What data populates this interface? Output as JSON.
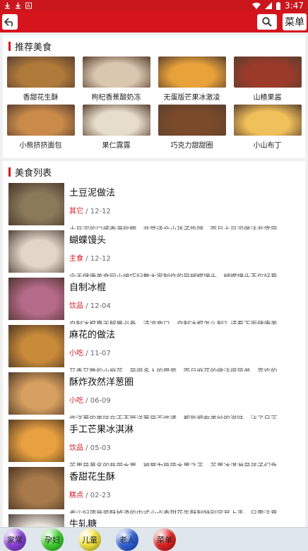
{
  "status": {
    "time": "3:47"
  },
  "topbar": {
    "menu_label": "菜单"
  },
  "recommend": {
    "title": "推荐美食",
    "items": [
      {
        "label": "香甜花生酥",
        "color": "#b07a3a"
      },
      {
        "label": "枸杞香蕉酸奶冻",
        "color": "#d9c7b0"
      },
      {
        "label": "无蛋版芒果冰激凌",
        "color": "#e9a23a"
      },
      {
        "label": "山楂果酱",
        "color": "#9c3a2a"
      },
      {
        "label": "小熊挤挤面包",
        "color": "#c98a4a"
      },
      {
        "label": "果仁露露",
        "color": "#e7ddcc"
      },
      {
        "label": "巧克力甜甜圈",
        "color": "#7a4a2a"
      },
      {
        "label": "小山布丁",
        "color": "#f0c05a"
      }
    ]
  },
  "food_list": {
    "title": "美食列表",
    "items": [
      {
        "title": "土豆泥做法",
        "category": "其它",
        "date": " / 12-12",
        "desc": "土豆泥的口感香滑软糯，非常适合小孩子吃哦。而且土豆泥做法非常简",
        "color": "#8a7a5a"
      },
      {
        "title": "蝴蝶馒头",
        "category": "主食",
        "date": " / 12-12",
        "desc": "今天健康美食网小编巧妇教大家制作的是蝴蝶馒头，蝴蝶馒头不仅好看",
        "color": "#e2d6c8"
      },
      {
        "title": "自制冰棍",
        "category": "饮品",
        "date": " / 12-04",
        "desc": "自制冰棍夏天解暑必备，清凉爽口。自制冰棍怎么制？请看下面健康美",
        "color": "#b66a8a"
      },
      {
        "title": "麻花的做法",
        "category": "小吃",
        "date": " / 11-07",
        "desc": "又香又脆的小麻花，是很多人的最爱，而且麻花的做法很简单，喜欢的",
        "color": "#c98a3a"
      },
      {
        "title": "酥炸孜然洋葱圈",
        "category": "小吃",
        "date": " / 06-09",
        "desc": "炸洋葱的美味在于不管洋葱是否炸透，都能拥有美妙的滋味，沾了日正",
        "color": "#d8a060"
      },
      {
        "title": "手工芒果冰淇淋",
        "category": "饮品",
        "date": " / 05-03",
        "desc": "芒果是著名的热带水果，被誉为热带水果之王，芒果冰淇淋是孩子们急",
        "color": "#e8a040"
      },
      {
        "title": "香甜花生酥",
        "category": "糕点",
        "date": " / 02-23",
        "desc": "老少妇孺皆爱酥掉渣的中式小点香甜花生酥制特别容易上手，只需注意",
        "color": "#a87a4a"
      },
      {
        "title": "牛轧糖",
        "category": "",
        "date": "",
        "desc": "",
        "color": "#e8e2da"
      }
    ]
  },
  "bottom_nav": [
    {
      "label": "家常",
      "color": "#8a3fd6"
    },
    {
      "label": "孕妇",
      "color": "#3fcf2f"
    },
    {
      "label": "儿童",
      "color": "#f2e23a"
    },
    {
      "label": "老人",
      "color": "#2f5fd6"
    },
    {
      "label": "菜单",
      "color": "#e02020"
    }
  ]
}
